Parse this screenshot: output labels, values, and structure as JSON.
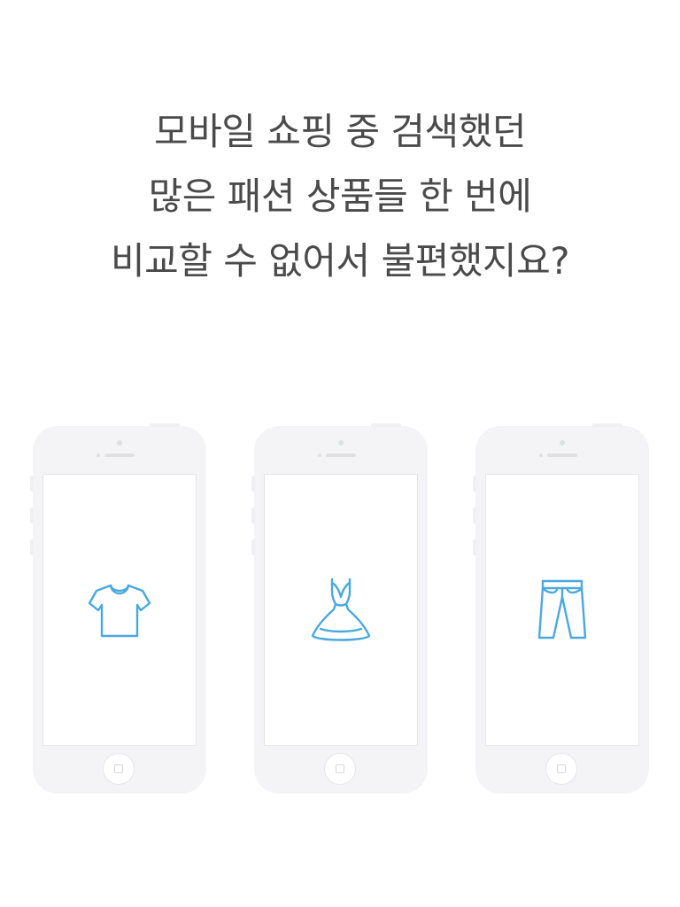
{
  "headline": {
    "lines": [
      "모바일 쇼핑 중 검색했던",
      "많은 패션 상품들 한 번에",
      "비교할 수 없어서 불편했지요?"
    ]
  },
  "phones": [
    {
      "icon": "tshirt-icon"
    },
    {
      "icon": "dress-icon"
    },
    {
      "icon": "pants-icon"
    }
  ],
  "colors": {
    "text": "#4a4a4a",
    "icon_accent": "#4aa8df",
    "phone_body": "#f4f4f6"
  }
}
